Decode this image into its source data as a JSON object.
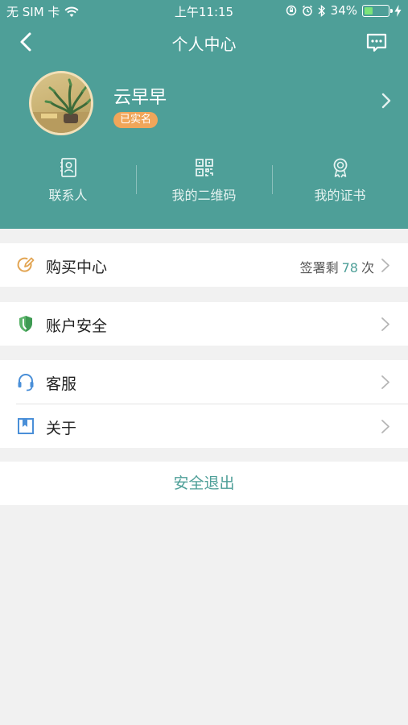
{
  "status_bar": {
    "carrier": "无 SIM 卡",
    "time": "上午11:15",
    "battery_percent": "34%",
    "battery_level": 0.34,
    "icons": [
      "wifi-icon",
      "orientation-lock-icon",
      "alarm-icon",
      "bluetooth-icon",
      "battery-icon",
      "charging-icon"
    ]
  },
  "nav": {
    "title": "个人中心",
    "back_icon": "chevron-left-icon",
    "message_icon": "message-icon"
  },
  "profile": {
    "name": "云早早",
    "badge": "已实名"
  },
  "quick_actions": [
    {
      "label": "联系人",
      "icon": "contacts-icon"
    },
    {
      "label": "我的二维码",
      "icon": "qr-code-icon"
    },
    {
      "label": "我的证书",
      "icon": "certificate-icon"
    }
  ],
  "menu": {
    "purchase": {
      "label": "购买中心",
      "quota_prefix": "签署剩",
      "quota_value": "78",
      "quota_suffix": "次",
      "icon": "edit-circle-icon"
    },
    "security": {
      "label": "账户安全",
      "icon": "shield-icon"
    },
    "service": {
      "label": "客服",
      "icon": "headset-icon"
    },
    "about": {
      "label": "关于",
      "icon": "bookmark-icon"
    }
  },
  "logout_label": "安全退出",
  "colors": {
    "brand": "#4e9f98",
    "badge": "#f0a65a",
    "background": "#f1f1f1"
  }
}
